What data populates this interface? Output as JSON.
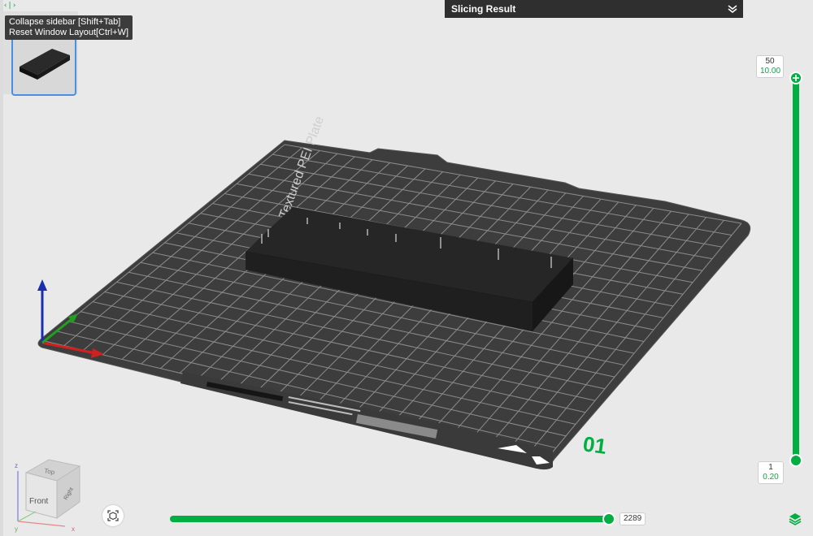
{
  "sidebar": {
    "toggle_icon": "collapse-arrows-icon",
    "tooltip": {
      "line1": "Collapse sidebar [Shift+Tab]",
      "line2": "Reset Window Layout[Ctrl+W]"
    }
  },
  "slicing_result": {
    "title": "Slicing Result",
    "expand_icon": "double-chevron-down-icon"
  },
  "plate": {
    "name": "Bambu Textured PEI Plate",
    "number": "01"
  },
  "layer_slider": {
    "top_layer": "50",
    "top_height": "10.00",
    "bottom_layer": "1",
    "bottom_height": "0.20",
    "add_icon": "plus-icon"
  },
  "move_slider": {
    "value": "2289",
    "progress": 1.0
  },
  "view_cube": {
    "front": "Front",
    "top": "Top",
    "right": "Right",
    "axis_x": "x",
    "axis_y": "y",
    "axis_z": "z"
  },
  "colors": {
    "accent": "#00ae42",
    "plate": "#3d3d3d",
    "grid": "#8a8a8a",
    "model": "#2a2a2a"
  },
  "bottom_icons": {
    "recenter": "recenter-view-icon",
    "layers": "layers-icon"
  }
}
